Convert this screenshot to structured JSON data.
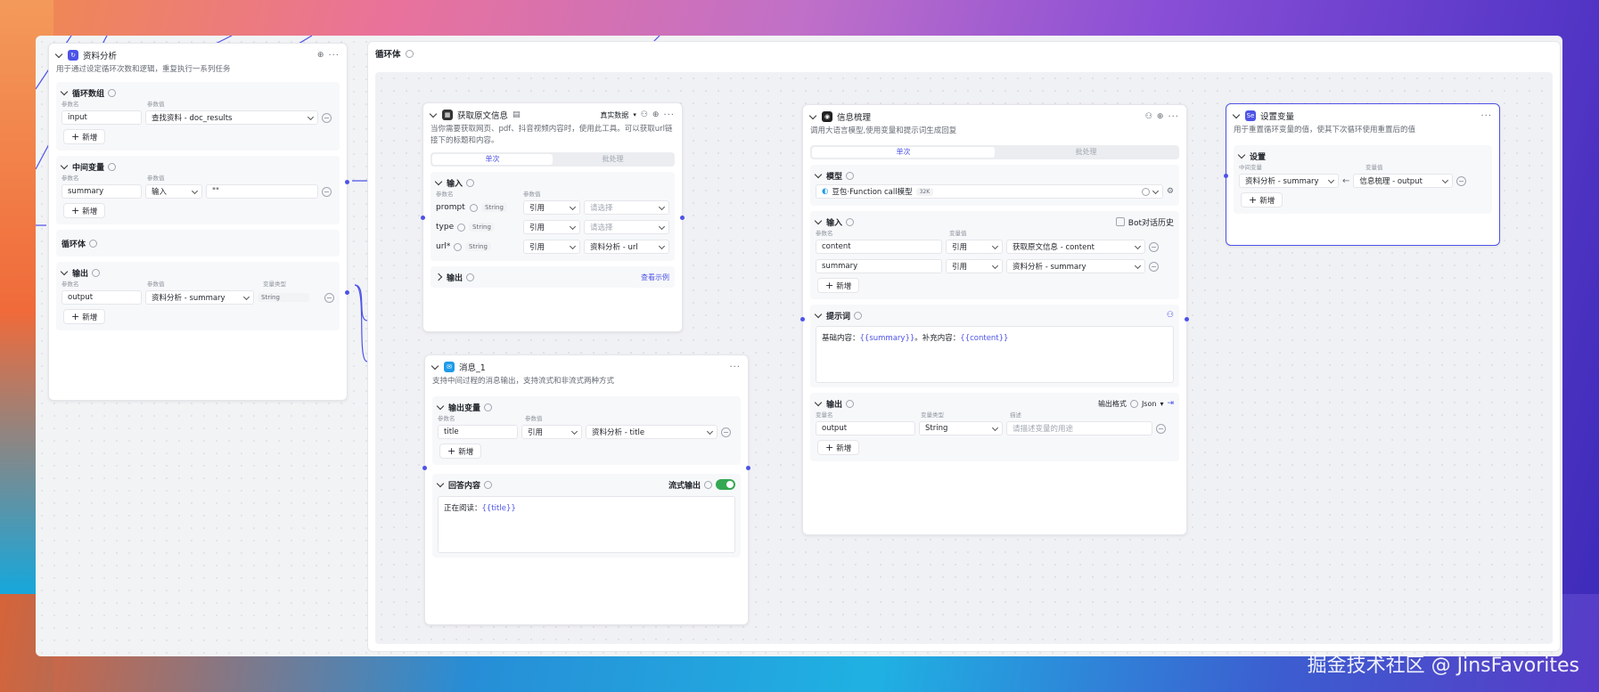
{
  "left_node": {
    "title": "资料分析",
    "desc": "用于通过设定循环次数和逻辑，重复执行一系列任务",
    "loop_array": {
      "title": "循环数组",
      "col1": "参数名",
      "col2": "参数值",
      "name": "input",
      "value": "查找资料 - doc_results",
      "add": "新增"
    },
    "mid_var": {
      "title": "中间变量",
      "col1": "参数名",
      "col2": "参数值",
      "name": "summary",
      "mode": "输入",
      "value": "\"\"",
      "add": "新增"
    },
    "loop_body": {
      "title": "循环体"
    },
    "output": {
      "title": "输出",
      "col1": "参数名",
      "col2": "参数值",
      "col3": "变量类型",
      "name": "output",
      "value": "资料分析 - summary",
      "type": "String",
      "add": "新增"
    }
  },
  "loop_body_panel": {
    "title": "循环体"
  },
  "fetch_node": {
    "title": "获取原文信息",
    "mode": "真实数据",
    "desc": "当你需要获取网页、pdf、抖音视频内容时，使用此工具。可以获取url链接下的标题和内容。",
    "tabs": [
      "单次",
      "批处理"
    ],
    "input_title": "输入",
    "col1": "参数名",
    "col2": "参数值",
    "params": [
      {
        "name": "prompt",
        "type": "String",
        "mode": "引用",
        "value": "请选择",
        "placeholder": true
      },
      {
        "name": "type",
        "type": "String",
        "mode": "引用",
        "value": "请选择",
        "placeholder": true
      },
      {
        "name": "url*",
        "type": "String",
        "mode": "引用",
        "value": "资料分析 - url",
        "placeholder": false
      }
    ],
    "output_title": "输出",
    "example_link": "查看示例"
  },
  "message_node": {
    "title": "消息_1",
    "desc": "支持中间过程的消息输出，支持流式和非流式两种方式",
    "out_var": {
      "title": "输出变量",
      "col1": "参数名",
      "col2": "参数值",
      "name": "title",
      "mode": "引用",
      "value": "资料分析 - title",
      "add": "新增"
    },
    "reply": {
      "title": "回答内容",
      "stream_label": "流式输出",
      "text_prefix": "正在阅读：",
      "text_var": "{{title}}"
    }
  },
  "llm_node": {
    "title": "信息梳理",
    "desc": "调用大语言模型,使用变量和提示词生成回复",
    "tabs": [
      "单次",
      "批处理"
    ],
    "model": {
      "title": "模型",
      "name": "豆包·Function call模型",
      "badge": "32K"
    },
    "input": {
      "title": "输入",
      "bot_history": "Bot对话历史",
      "col1": "参数名",
      "col2": "变量值",
      "rows": [
        {
          "name": "content",
          "mode": "引用",
          "value": "获取原文信息 - content"
        },
        {
          "name": "summary",
          "mode": "引用",
          "value": "资料分析 - summary"
        }
      ],
      "add": "新增"
    },
    "prompt": {
      "title": "提示词",
      "p1": "基础内容：",
      "v1": "{{summary}}",
      "p2": "。补充内容：",
      "v2": "{{content}}"
    },
    "output": {
      "title": "输出",
      "format_label": "输出格式",
      "format_value": "Json",
      "col1": "变量名",
      "col2": "变量类型",
      "col3": "描述",
      "name": "output",
      "type": "String",
      "desc_placeholder": "请描述变量的用途",
      "add": "新增"
    }
  },
  "setvar_node": {
    "title": "设置变量",
    "desc": "用于重置循环变量的值，使其下次循环使用重置后的值",
    "settings": {
      "title": "设置",
      "col1": "中间变量",
      "col2": "变量值",
      "left": "资料分析 - summary",
      "right": "信息梳理 - output",
      "add": "新增"
    }
  },
  "watermark": "掘金技术社区 @ JinsFavorites",
  "colors": {
    "accent": "#4d53e8",
    "toggle": "#34a853"
  }
}
